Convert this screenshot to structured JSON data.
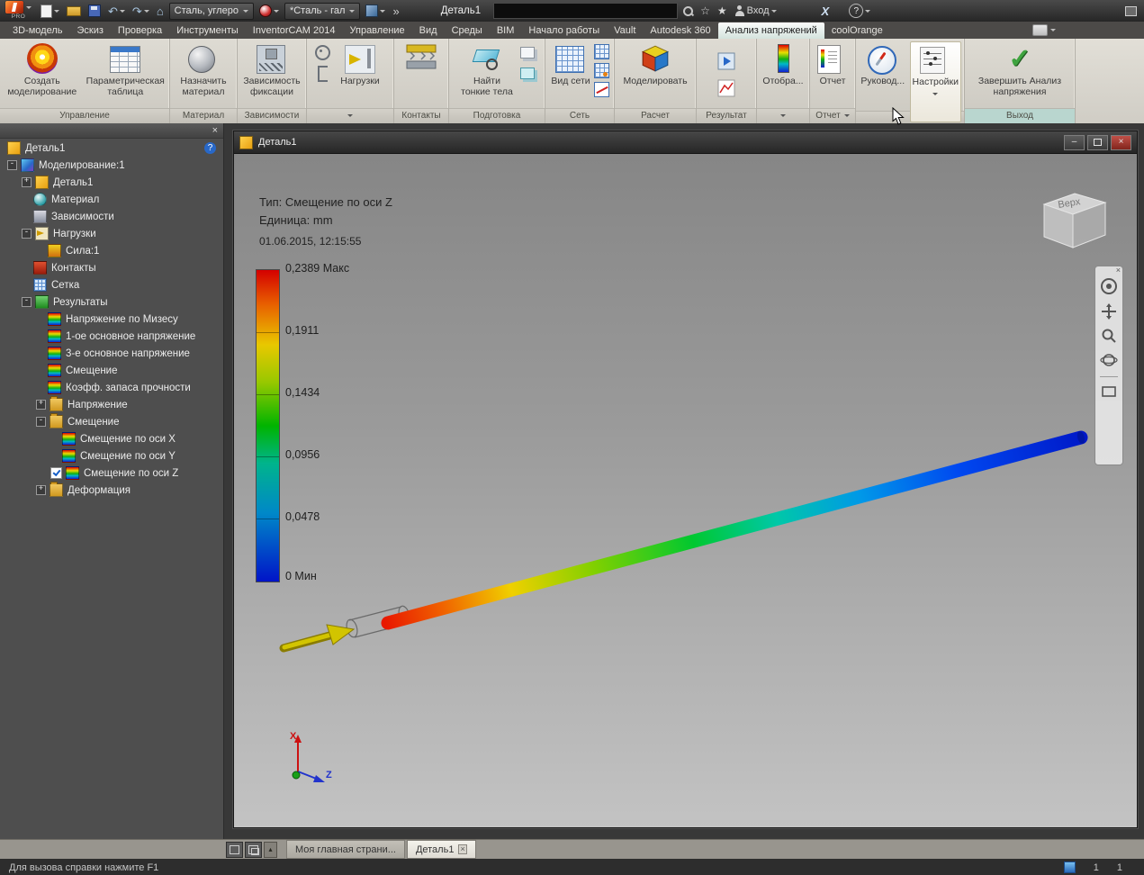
{
  "titlebar": {
    "app_badge": "PRO",
    "material_combo": "Сталь, углеро",
    "appearance_combo": "*Сталь - гал",
    "doc_title": "Деталь1",
    "signin": "Вход",
    "help": "?",
    "exchange": "X"
  },
  "icons": {
    "undo": "↶",
    "redo": "↷",
    "home": "⌂",
    "overflow": "»",
    "star": "★",
    "star_outline": "☆",
    "close": "×",
    "minimize": "–",
    "up": "▴",
    "check": "✓"
  },
  "tabs": {
    "items": [
      "3D-модель",
      "Эскиз",
      "Проверка",
      "Инструменты",
      "InventorCAM 2014",
      "Управление",
      "Вид",
      "Среды",
      "BIM",
      "Начало работы",
      "Vault",
      "Autodesk 360",
      "Анализ напряжений",
      "coolOrange"
    ]
  },
  "ribbon": {
    "manage_label": "Управление",
    "create_sim": "Создать моделирование",
    "param_table": "Параметрическая таблица",
    "material_label": "Материал",
    "assign_material": "Назначить материал",
    "constraints_label": "Зависимости",
    "fixture": "Зависимость фиксации",
    "loads": "Нагрузки",
    "contacts_label": "Контакты",
    "prepare_label": "Подготовка",
    "thin_bodies": "Найти тонкие тела",
    "mesh_label": "Сеть",
    "mesh_view": "Вид сети",
    "solve_label": "Расчет",
    "simulate": "Моделировать",
    "result_label": "Результат",
    "display_btn": "Отобра...",
    "report_btn": "Отчет",
    "report_label": "Отчет",
    "guide_btn": "Руковод...",
    "settings_btn": "Настройки",
    "finish_btn": "Завершить Анализ напряжения",
    "exit_label": "Выход"
  },
  "browser": {
    "help_badge": "?",
    "items": [
      {
        "label": "Деталь1",
        "level": 0
      },
      {
        "label": "Моделирование:1",
        "level": 1,
        "exp": "-"
      },
      {
        "label": "Деталь1",
        "level": 2,
        "exp": "+"
      },
      {
        "label": "Материал",
        "level": 2
      },
      {
        "label": "Зависимости",
        "level": 2
      },
      {
        "label": "Нагрузки",
        "level": 2,
        "exp": "-"
      },
      {
        "label": "Сила:1",
        "level": 3
      },
      {
        "label": "Контакты",
        "level": 2
      },
      {
        "label": "Сетка",
        "level": 2
      },
      {
        "label": "Результаты",
        "level": 2,
        "exp": "-"
      },
      {
        "label": "Напряжение по Мизесу",
        "level": 3
      },
      {
        "label": "1-ое основное напряжение",
        "level": 3
      },
      {
        "label": "3-е основное напряжение",
        "level": 3
      },
      {
        "label": "Смещение",
        "level": 3
      },
      {
        "label": "Коэфф. запаса прочности",
        "level": 3
      },
      {
        "label": "Напряжение",
        "level": 3,
        "exp": "+"
      },
      {
        "label": "Смещение",
        "level": 3,
        "exp": "-"
      },
      {
        "label": "Смещение по оси X",
        "level": 4
      },
      {
        "label": "Смещение по оси Y",
        "level": 4
      },
      {
        "label": "Смещение по оси Z",
        "level": 4,
        "checked": true
      },
      {
        "label": "Деформация",
        "level": 3,
        "exp": "+"
      }
    ]
  },
  "doc": {
    "title": "Деталь1"
  },
  "viewport": {
    "info_type": "Тип: Смещение по оси Z",
    "info_unit": "Единица: mm",
    "info_time": "01.06.2015, 12:15:55",
    "legend": {
      "entries": [
        "0,2389 Макс",
        "0,1911",
        "0,1434",
        "0,0956",
        "0,0478",
        "0 Мин"
      ]
    },
    "viewcube": "Верх",
    "axis_x": "X",
    "axis_z": "Z"
  },
  "bottom": {
    "tab_home": "Моя главная страни...",
    "tab_doc": "Деталь1",
    "status": "Для вызова справки нажмите F1",
    "count_a": "1",
    "count_b": "1"
  }
}
